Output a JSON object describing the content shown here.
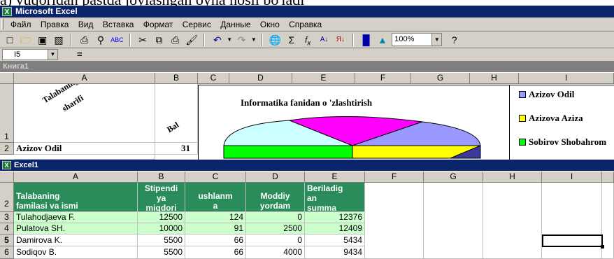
{
  "doc_text": "a) yuqoridan pastda joylashgan oyna hosil bo'ladi",
  "app": {
    "title": "Microsoft Excel",
    "icon": "excel-icon"
  },
  "menu": [
    "Файл",
    "Правка",
    "Вид",
    "Вставка",
    "Формат",
    "Сервис",
    "Данные",
    "Окно",
    "Справка"
  ],
  "toolbar": {
    "icons": [
      "new-icon",
      "open-icon",
      "save-icon",
      "permission-icon",
      "print-icon",
      "print-preview-icon",
      "spelling-icon",
      "cut-icon",
      "copy-icon",
      "paste-icon",
      "format-painter-icon",
      "undo-icon",
      "redo-icon",
      "hyperlink-icon",
      "autosum-icon",
      "function-icon",
      "sort-ascending-icon",
      "sort-descending-icon",
      "chart-wizard-icon",
      "drawing-icon",
      "help-icon"
    ],
    "zoom": "100%"
  },
  "formula_bar": {
    "name_box": "I5",
    "equals": "="
  },
  "book1": {
    "title": "Книга1",
    "columns": [
      "A",
      "B",
      "C",
      "D",
      "E",
      "F",
      "G",
      "H",
      "I"
    ],
    "rows": [
      "1",
      "2"
    ],
    "a1_line1": "Talabaning ism",
    "a1_line2": "sharifi",
    "b1": "Bal",
    "a2": "Azizov Odil",
    "b2": "31",
    "chart": {
      "title": "Informatika fanidan o 'zlashtirish",
      "legend": [
        "Azizov Odil",
        "Azizova Aziza",
        "Sobirov Shobahrom"
      ],
      "legend_colors": [
        "#9999ff",
        "#ffff00",
        "#00ff00"
      ]
    }
  },
  "excel1": {
    "title": "Excel1",
    "columns": [
      "A",
      "B",
      "C",
      "D",
      "E",
      "F",
      "G",
      "H",
      "I"
    ],
    "rows": [
      "2",
      "3",
      "4",
      "5",
      "6"
    ],
    "headers": [
      "Talabaning familasi va ismi",
      "Stipendiya miqdori",
      "ushlanma",
      "Moddiy yordam",
      "Beriladigan summa"
    ],
    "header_lines": [
      [
        "Talabaning",
        "familasi va ismi"
      ],
      [
        "Stipendi",
        "ya",
        "miqdori"
      ],
      [
        "ushlanm",
        "a"
      ],
      [
        "Moddiy",
        "yordam"
      ],
      [
        "Beriladig",
        "an",
        "summa"
      ]
    ],
    "data": [
      [
        "Tulahodjaeva F.",
        "12500",
        "124",
        "0",
        "12376"
      ],
      [
        "Pulatova SH.",
        "10000",
        "91",
        "2500",
        "12409"
      ],
      [
        "Damirova K.",
        "5500",
        "66",
        "0",
        "5434"
      ],
      [
        "Sodiqov B.",
        "5500",
        "66",
        "4000",
        "9434"
      ]
    ]
  }
}
